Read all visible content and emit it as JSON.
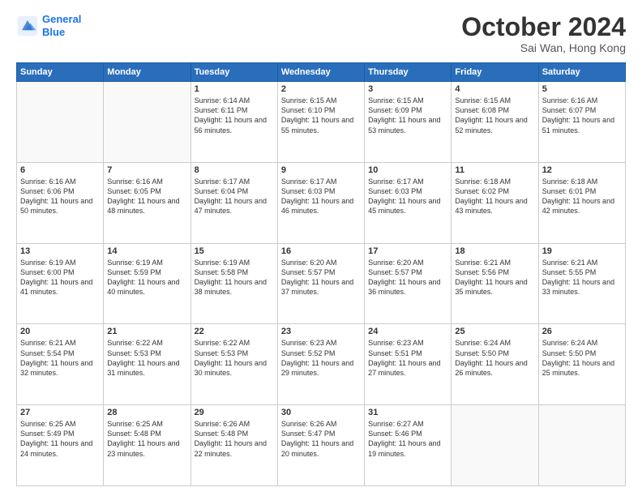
{
  "header": {
    "logo_line1": "General",
    "logo_line2": "Blue",
    "month": "October 2024",
    "location": "Sai Wan, Hong Kong"
  },
  "days_of_week": [
    "Sunday",
    "Monday",
    "Tuesday",
    "Wednesday",
    "Thursday",
    "Friday",
    "Saturday"
  ],
  "weeks": [
    [
      {
        "day": "",
        "info": ""
      },
      {
        "day": "",
        "info": ""
      },
      {
        "day": "1",
        "info": "Sunrise: 6:14 AM\nSunset: 6:11 PM\nDaylight: 11 hours and 56 minutes."
      },
      {
        "day": "2",
        "info": "Sunrise: 6:15 AM\nSunset: 6:10 PM\nDaylight: 11 hours and 55 minutes."
      },
      {
        "day": "3",
        "info": "Sunrise: 6:15 AM\nSunset: 6:09 PM\nDaylight: 11 hours and 53 minutes."
      },
      {
        "day": "4",
        "info": "Sunrise: 6:15 AM\nSunset: 6:08 PM\nDaylight: 11 hours and 52 minutes."
      },
      {
        "day": "5",
        "info": "Sunrise: 6:16 AM\nSunset: 6:07 PM\nDaylight: 11 hours and 51 minutes."
      }
    ],
    [
      {
        "day": "6",
        "info": "Sunrise: 6:16 AM\nSunset: 6:06 PM\nDaylight: 11 hours and 50 minutes."
      },
      {
        "day": "7",
        "info": "Sunrise: 6:16 AM\nSunset: 6:05 PM\nDaylight: 11 hours and 48 minutes."
      },
      {
        "day": "8",
        "info": "Sunrise: 6:17 AM\nSunset: 6:04 PM\nDaylight: 11 hours and 47 minutes."
      },
      {
        "day": "9",
        "info": "Sunrise: 6:17 AM\nSunset: 6:03 PM\nDaylight: 11 hours and 46 minutes."
      },
      {
        "day": "10",
        "info": "Sunrise: 6:17 AM\nSunset: 6:03 PM\nDaylight: 11 hours and 45 minutes."
      },
      {
        "day": "11",
        "info": "Sunrise: 6:18 AM\nSunset: 6:02 PM\nDaylight: 11 hours and 43 minutes."
      },
      {
        "day": "12",
        "info": "Sunrise: 6:18 AM\nSunset: 6:01 PM\nDaylight: 11 hours and 42 minutes."
      }
    ],
    [
      {
        "day": "13",
        "info": "Sunrise: 6:19 AM\nSunset: 6:00 PM\nDaylight: 11 hours and 41 minutes."
      },
      {
        "day": "14",
        "info": "Sunrise: 6:19 AM\nSunset: 5:59 PM\nDaylight: 11 hours and 40 minutes."
      },
      {
        "day": "15",
        "info": "Sunrise: 6:19 AM\nSunset: 5:58 PM\nDaylight: 11 hours and 38 minutes."
      },
      {
        "day": "16",
        "info": "Sunrise: 6:20 AM\nSunset: 5:57 PM\nDaylight: 11 hours and 37 minutes."
      },
      {
        "day": "17",
        "info": "Sunrise: 6:20 AM\nSunset: 5:57 PM\nDaylight: 11 hours and 36 minutes."
      },
      {
        "day": "18",
        "info": "Sunrise: 6:21 AM\nSunset: 5:56 PM\nDaylight: 11 hours and 35 minutes."
      },
      {
        "day": "19",
        "info": "Sunrise: 6:21 AM\nSunset: 5:55 PM\nDaylight: 11 hours and 33 minutes."
      }
    ],
    [
      {
        "day": "20",
        "info": "Sunrise: 6:21 AM\nSunset: 5:54 PM\nDaylight: 11 hours and 32 minutes."
      },
      {
        "day": "21",
        "info": "Sunrise: 6:22 AM\nSunset: 5:53 PM\nDaylight: 11 hours and 31 minutes."
      },
      {
        "day": "22",
        "info": "Sunrise: 6:22 AM\nSunset: 5:53 PM\nDaylight: 11 hours and 30 minutes."
      },
      {
        "day": "23",
        "info": "Sunrise: 6:23 AM\nSunset: 5:52 PM\nDaylight: 11 hours and 29 minutes."
      },
      {
        "day": "24",
        "info": "Sunrise: 6:23 AM\nSunset: 5:51 PM\nDaylight: 11 hours and 27 minutes."
      },
      {
        "day": "25",
        "info": "Sunrise: 6:24 AM\nSunset: 5:50 PM\nDaylight: 11 hours and 26 minutes."
      },
      {
        "day": "26",
        "info": "Sunrise: 6:24 AM\nSunset: 5:50 PM\nDaylight: 11 hours and 25 minutes."
      }
    ],
    [
      {
        "day": "27",
        "info": "Sunrise: 6:25 AM\nSunset: 5:49 PM\nDaylight: 11 hours and 24 minutes."
      },
      {
        "day": "28",
        "info": "Sunrise: 6:25 AM\nSunset: 5:48 PM\nDaylight: 11 hours and 23 minutes."
      },
      {
        "day": "29",
        "info": "Sunrise: 6:26 AM\nSunset: 5:48 PM\nDaylight: 11 hours and 22 minutes."
      },
      {
        "day": "30",
        "info": "Sunrise: 6:26 AM\nSunset: 5:47 PM\nDaylight: 11 hours and 20 minutes."
      },
      {
        "day": "31",
        "info": "Sunrise: 6:27 AM\nSunset: 5:46 PM\nDaylight: 11 hours and 19 minutes."
      },
      {
        "day": "",
        "info": ""
      },
      {
        "day": "",
        "info": ""
      }
    ]
  ]
}
